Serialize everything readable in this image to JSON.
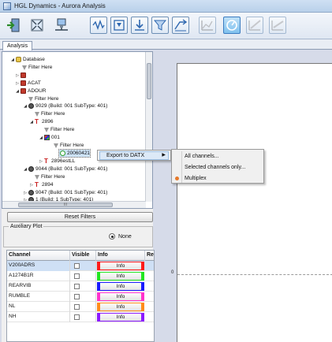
{
  "window": {
    "title": "HGL Dynamics - Aurora Analysis"
  },
  "toolbar": {
    "buttons": [
      {
        "name": "exit-icon"
      },
      {
        "name": "fullscreen-icon"
      },
      {
        "name": "network-icon"
      },
      {
        "name": "waveform-icon"
      },
      {
        "name": "filter-view-icon"
      },
      {
        "name": "download-icon"
      },
      {
        "name": "funnel-icon"
      },
      {
        "name": "export-icon"
      },
      {
        "name": "chart-icon"
      },
      {
        "name": "dial-icon"
      },
      {
        "name": "graph-icon"
      },
      {
        "name": "line-graph-icon"
      }
    ]
  },
  "tabs": {
    "analysis": "Analysis"
  },
  "tree": {
    "rows": [
      "Database",
      "Filter Here",
      "",
      "ACAT",
      "ADOUR",
      "Filter Here",
      "9029 (Build: 001  SubType: 401)",
      "Filter Here",
      "2896",
      "Filter Here",
      "001",
      "Filter Here",
      "20060421",
      "2896estLL",
      "9044 (Build: 001  SubType: 401)",
      "Filter Here",
      "2894",
      "9047 (Build: 001  SubType: 401)",
      "1 (Build: 1  SubType: 401)"
    ],
    "scroll_glyph": "III"
  },
  "buttons": {
    "reset_filters": "Reset Filters"
  },
  "auxiliary": {
    "title": "Auxiliary Plot",
    "none_label": "None"
  },
  "channels": {
    "headers": {
      "channel": "Channel",
      "visible": "Visible",
      "info": "Info",
      "extra": "Re"
    },
    "rows": [
      {
        "name": "V200ADRS",
        "info": "Info",
        "color": "#ff1a1a"
      },
      {
        "name": "A1274B1R",
        "info": "Info",
        "color": "#22e622"
      },
      {
        "name": "REARVIB",
        "info": "Info",
        "color": "#1a1aff"
      },
      {
        "name": "RUMBLE",
        "info": "Info",
        "color": "#ff33cc"
      },
      {
        "name": "NL",
        "info": "Info",
        "color": "#ff8c1a"
      },
      {
        "name": "NH",
        "info": "Info",
        "color": "#8c1aff"
      }
    ]
  },
  "context_menu": {
    "export": "Export to DATX"
  },
  "submenu": {
    "all": "All channels...",
    "selected": "Selected channels only...",
    "multiplex": "Multiplex"
  },
  "plot": {
    "zero_label": "0"
  }
}
